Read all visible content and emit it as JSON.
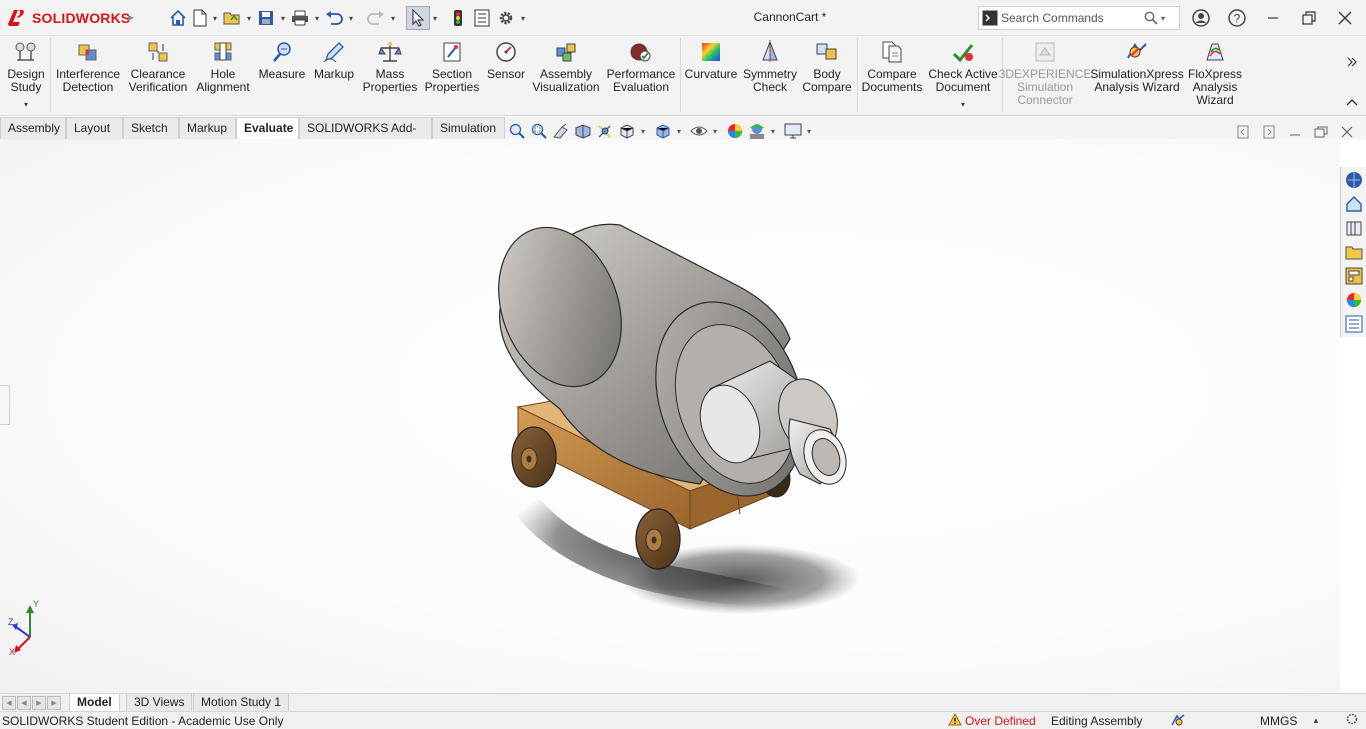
{
  "app": {
    "brand": "SOLIDWORKS",
    "document_title": "CannonCart *",
    "accent": "#d6141a"
  },
  "search": {
    "placeholder": "Search Commands"
  },
  "ribbon": {
    "items": [
      {
        "label": "Design\nStudy",
        "icon": "design-study-icon"
      },
      {
        "label": "Interference\nDetection",
        "icon": "interference-detection-icon"
      },
      {
        "label": "Clearance\nVerification",
        "icon": "clearance-verification-icon"
      },
      {
        "label": "Hole\nAlignment",
        "icon": "hole-alignment-icon"
      },
      {
        "label": "Measure",
        "icon": "measure-icon"
      },
      {
        "label": "Markup",
        "icon": "markup-icon"
      },
      {
        "label": "Mass\nProperties",
        "icon": "mass-properties-icon"
      },
      {
        "label": "Section\nProperties",
        "icon": "section-properties-icon"
      },
      {
        "label": "Sensor",
        "icon": "sensor-icon"
      },
      {
        "label": "Assembly\nVisualization",
        "icon": "assembly-visualization-icon"
      },
      {
        "label": "Performance\nEvaluation",
        "icon": "performance-evaluation-icon"
      },
      {
        "label": "Curvature",
        "icon": "curvature-icon"
      },
      {
        "label": "Symmetry\nCheck",
        "icon": "symmetry-check-icon"
      },
      {
        "label": "Body\nCompare",
        "icon": "body-compare-icon"
      },
      {
        "label": "Compare\nDocuments",
        "icon": "compare-documents-icon"
      },
      {
        "label": "Check Active\nDocument",
        "icon": "check-active-document-icon"
      },
      {
        "label": "3DEXPERIENCE\nSimulation\nConnector",
        "icon": "simulation-connector-icon",
        "disabled": true
      },
      {
        "label": "SimulationXpress\nAnalysis Wizard",
        "icon": "simulationxpress-icon"
      },
      {
        "label": "FloXpress\nAnalysis\nWizard",
        "icon": "floxpress-icon"
      }
    ]
  },
  "tabs": [
    "Assembly",
    "Layout",
    "Sketch",
    "Markup",
    "Evaluate",
    "SOLIDWORKS Add-Ins",
    "Simulation"
  ],
  "active_tab": "Evaluate",
  "bottom_tabs": [
    "Model",
    "3D Views",
    "Motion Study 1"
  ],
  "active_bottom_tab": "Model",
  "status": {
    "edition": "SOLIDWORKS Student Edition - Academic Use Only",
    "over_defined": "Over Defined",
    "editing": "Editing Assembly",
    "units": "MMGS"
  },
  "triad": {
    "x": "X",
    "y": "Y",
    "z": "Z"
  },
  "colors": {
    "barrel": "#9e9995",
    "cart_wood": "#b07a3c",
    "wheel": "#6a4a28",
    "warning": "#d6141a"
  }
}
